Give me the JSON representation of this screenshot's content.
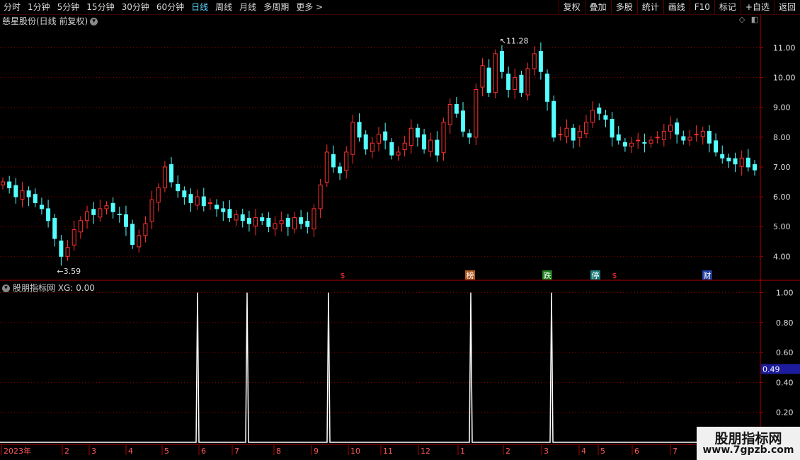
{
  "toolbar": {
    "periods": [
      "分时",
      "1分钟",
      "5分钟",
      "15分钟",
      "30分钟",
      "60分钟",
      "日线",
      "周线",
      "月线",
      "多周期",
      "更多 >"
    ],
    "selected": "日线",
    "actions": [
      "复权",
      "叠加",
      "多股",
      "统计",
      "画线",
      "F10",
      "标记",
      "+自选",
      "返回"
    ]
  },
  "main_panel": {
    "title": "慈星股份(日线 前复权)",
    "title_menu_icon": "chevron-down-icon",
    "right_icons": [
      "diamond-icon",
      "panel-toggle-icon"
    ]
  },
  "sub_panel": {
    "title": "股朋指标网 XG: 0.00",
    "current_value": "0.49"
  },
  "colors": {
    "up": "#ff3030",
    "down": "#54ffff",
    "grid": "#8b0000",
    "axis": "#b00000",
    "line": "#ffffff",
    "value_box": "#1c1c9c"
  },
  "chart_data": [
    {
      "type": "candlestick",
      "title": "慈星股份(日线 前复权)",
      "y_ticks": [
        "4.00",
        "5.00",
        "6.00",
        "7.00",
        "8.00",
        "9.00",
        "10.00",
        "11.00"
      ],
      "ylim": [
        3.2,
        11.7
      ],
      "high_label": "11.28",
      "low_label": "3.59",
      "markers": [
        "$",
        "榜",
        "跌",
        "停",
        "$",
        "财"
      ],
      "series": [
        {
          "name": "close",
          "values": [
            6.5,
            6.3,
            6.0,
            6.2,
            6.0,
            5.8,
            5.6,
            5.2,
            4.6,
            4.0,
            4.3,
            4.9,
            5.2,
            5.5,
            5.4,
            5.6,
            5.7,
            5.5,
            5.4,
            5.0,
            4.4,
            4.7,
            5.1,
            5.9,
            6.3,
            7.0,
            6.5,
            6.2,
            6.0,
            5.8,
            6.0,
            5.7,
            5.8,
            5.6,
            5.5,
            5.3,
            5.4,
            5.2,
            5.1,
            5.3,
            5.2,
            5.0,
            5.1,
            5.2,
            5.0,
            5.3,
            5.1,
            5.0,
            5.6,
            6.4,
            7.5,
            7.0,
            6.8,
            7.5,
            8.5,
            8.0,
            7.6,
            7.8,
            8.1,
            7.9,
            7.4,
            7.5,
            7.8,
            8.3,
            8.0,
            7.6,
            7.9,
            7.4,
            8.5,
            9.1,
            8.8,
            8.2,
            8.0,
            9.6,
            10.4,
            9.5,
            10.8,
            10.2,
            9.6,
            10.0,
            9.5,
            10.3,
            10.8,
            10.2,
            9.2,
            8.0,
            8.1,
            8.3,
            7.9,
            8.2,
            8.5,
            8.9,
            8.8,
            8.6,
            8.0,
            7.9,
            7.7,
            7.8,
            7.9,
            7.8,
            7.9,
            8.0,
            8.2,
            8.4,
            8.1,
            7.9,
            8.0,
            8.1,
            8.2,
            7.8,
            7.5,
            7.3,
            7.2,
            7.1,
            7.3,
            7.0,
            6.9
          ]
        }
      ],
      "x_ticks": [
        "2023年",
        "2",
        "3",
        "4",
        "5",
        "6",
        "7",
        "8",
        "9",
        "10",
        "11",
        "12",
        "1",
        "2",
        "3",
        "4",
        "5",
        "6",
        "7",
        "8",
        "9"
      ]
    },
    {
      "type": "line",
      "title": "股朋指标网 XG",
      "y_ticks": [
        "0.20",
        "0.40",
        "0.60",
        "0.80",
        "1.00"
      ],
      "ylim": [
        0,
        1.04
      ],
      "series": [
        {
          "name": "XG",
          "x_ticks_with_spike": [
            "6",
            "7",
            "9 ~ 10",
            "1 ~ 2",
            "4"
          ],
          "values": [
            0,
            1,
            0,
            1,
            0,
            1,
            0,
            1,
            0,
            1,
            0
          ]
        }
      ]
    }
  ],
  "watermark": {
    "line1": "股朋指标网",
    "line2": "www.7gpzb.com"
  }
}
